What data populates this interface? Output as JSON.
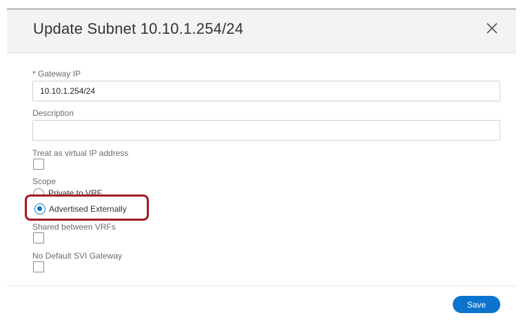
{
  "dialog": {
    "title": "Update Subnet 10.10.1.254/24",
    "close_icon": "close-icon"
  },
  "form": {
    "gateway_ip": {
      "label": "* Gateway IP",
      "value": "10.10.1.254/24"
    },
    "description": {
      "label": "Description",
      "value": ""
    },
    "virtual_ip": {
      "label": "Treat as virtual IP address",
      "checked": false
    },
    "scope": {
      "label": "Scope",
      "options": [
        {
          "label": "Private to VRF",
          "selected": false
        },
        {
          "label": "Advertised Externally",
          "selected": true
        }
      ]
    },
    "shared_between_vrfs": {
      "label": "Shared between VRFs",
      "checked": false
    },
    "no_default_svi_gateway": {
      "label": "No Default SVI Gateway",
      "checked": false
    }
  },
  "footer": {
    "save_label": "Save"
  },
  "colors": {
    "accent": "#0d74ce",
    "highlight_box": "#a3191f",
    "header_bg": "#f3f3f3"
  }
}
